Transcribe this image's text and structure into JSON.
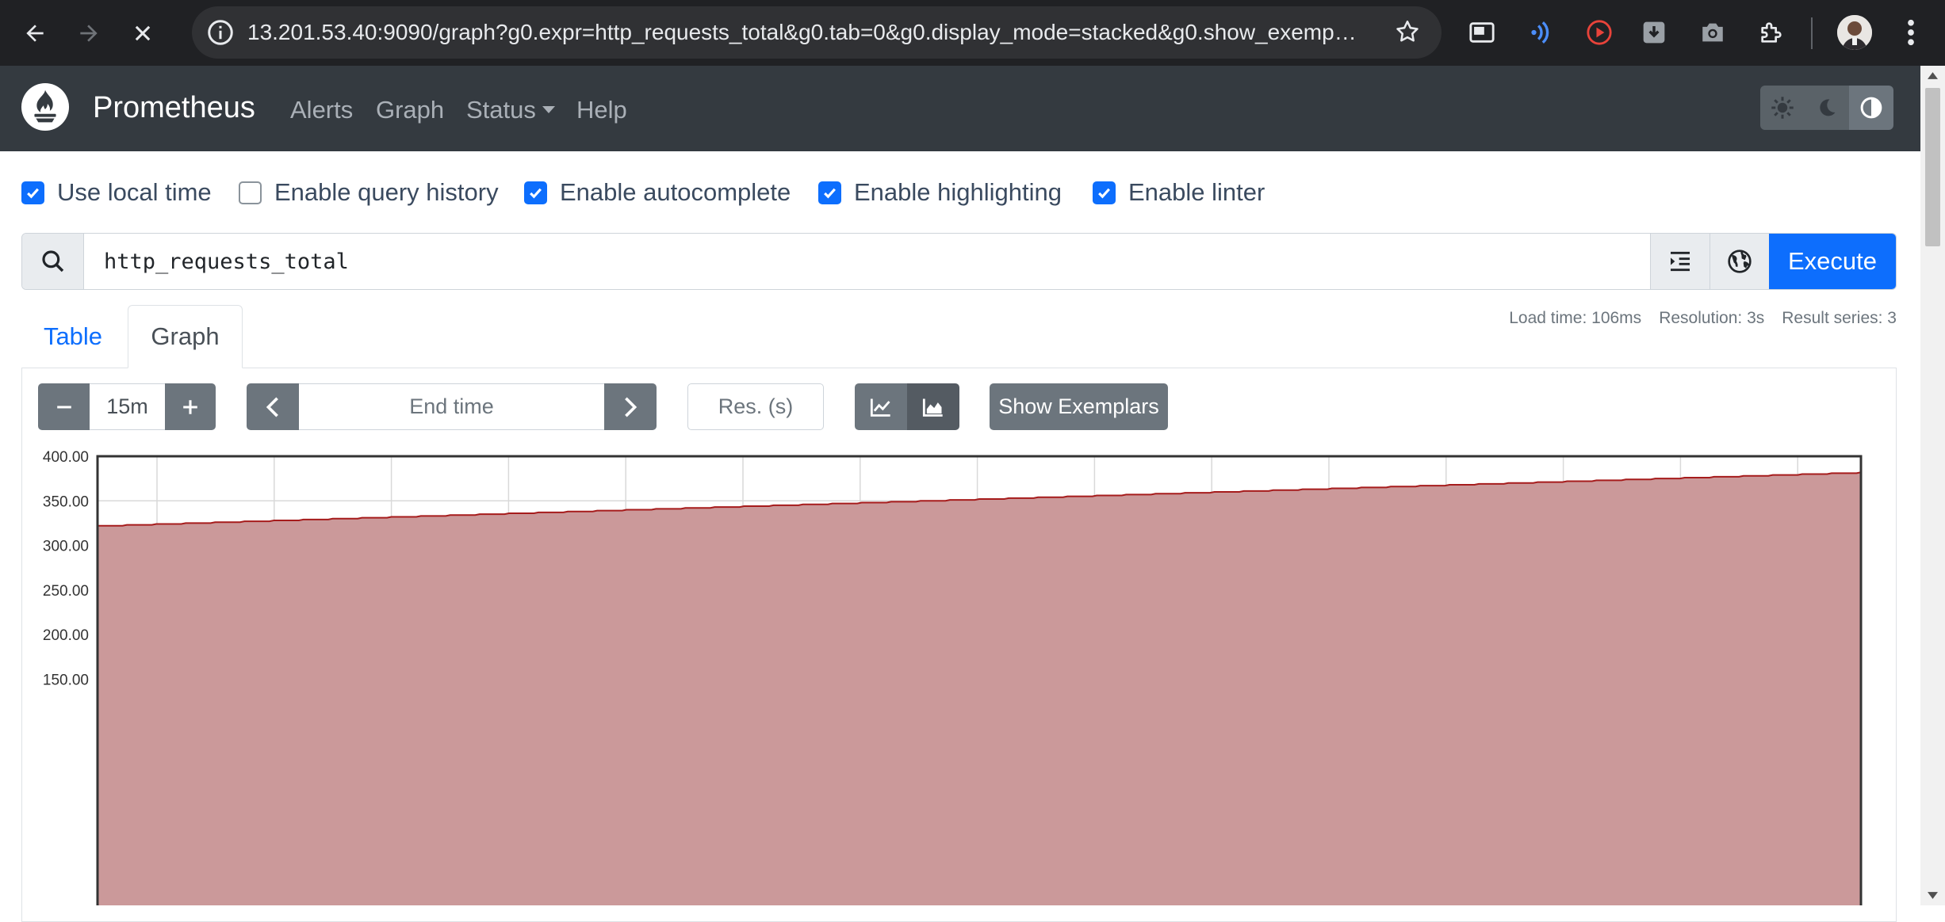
{
  "browser": {
    "url": "13.201.53.40:9090/graph?g0.expr=http_requests_total&g0.tab=0&g0.display_mode=stacked&g0.show_exemplar..."
  },
  "navbar": {
    "brand": "Prometheus",
    "links": [
      "Alerts",
      "Graph",
      "Status",
      "Help"
    ]
  },
  "options": [
    {
      "label": "Use local time",
      "checked": true
    },
    {
      "label": "Enable query history",
      "checked": false
    },
    {
      "label": "Enable autocomplete",
      "checked": true
    },
    {
      "label": "Enable highlighting",
      "checked": true
    },
    {
      "label": "Enable linter",
      "checked": true
    }
  ],
  "query": {
    "expression": "http_requests_total",
    "execute_label": "Execute"
  },
  "stats": {
    "load_time": "Load time: 106ms",
    "resolution": "Resolution: 3s",
    "result_series": "Result series: 3"
  },
  "tabs": [
    "Table",
    "Graph"
  ],
  "controls": {
    "range": "15m",
    "end_time_placeholder": "End time",
    "resolution_placeholder": "Res. (s)",
    "exemplars_label": "Show Exemplars"
  },
  "colors": {
    "accent": "#0d6efd",
    "navbar": "#343a40",
    "series_fill": "#cb999a",
    "series_line": "#a61c1c"
  },
  "chart_data": {
    "type": "area",
    "display_mode": "stacked",
    "y_ticks": [
      "400.00",
      "350.00",
      "300.00",
      "250.00",
      "200.00",
      "150.00"
    ],
    "ylim": [
      150,
      400
    ],
    "grid": true,
    "series": [
      {
        "values": [
          322,
          323,
          324,
          325,
          326,
          327,
          328,
          329,
          330,
          331,
          332,
          333,
          334,
          335,
          336,
          337,
          338,
          339,
          340,
          341,
          342,
          343,
          344,
          345,
          346,
          347,
          348,
          349,
          350,
          351,
          352,
          353,
          354,
          355,
          356,
          357,
          358,
          359,
          360,
          361,
          362,
          363,
          364,
          365,
          366,
          367,
          368,
          369,
          370,
          371,
          372,
          373,
          374,
          375,
          376,
          377,
          378,
          379,
          380,
          381,
          382
        ]
      }
    ]
  }
}
